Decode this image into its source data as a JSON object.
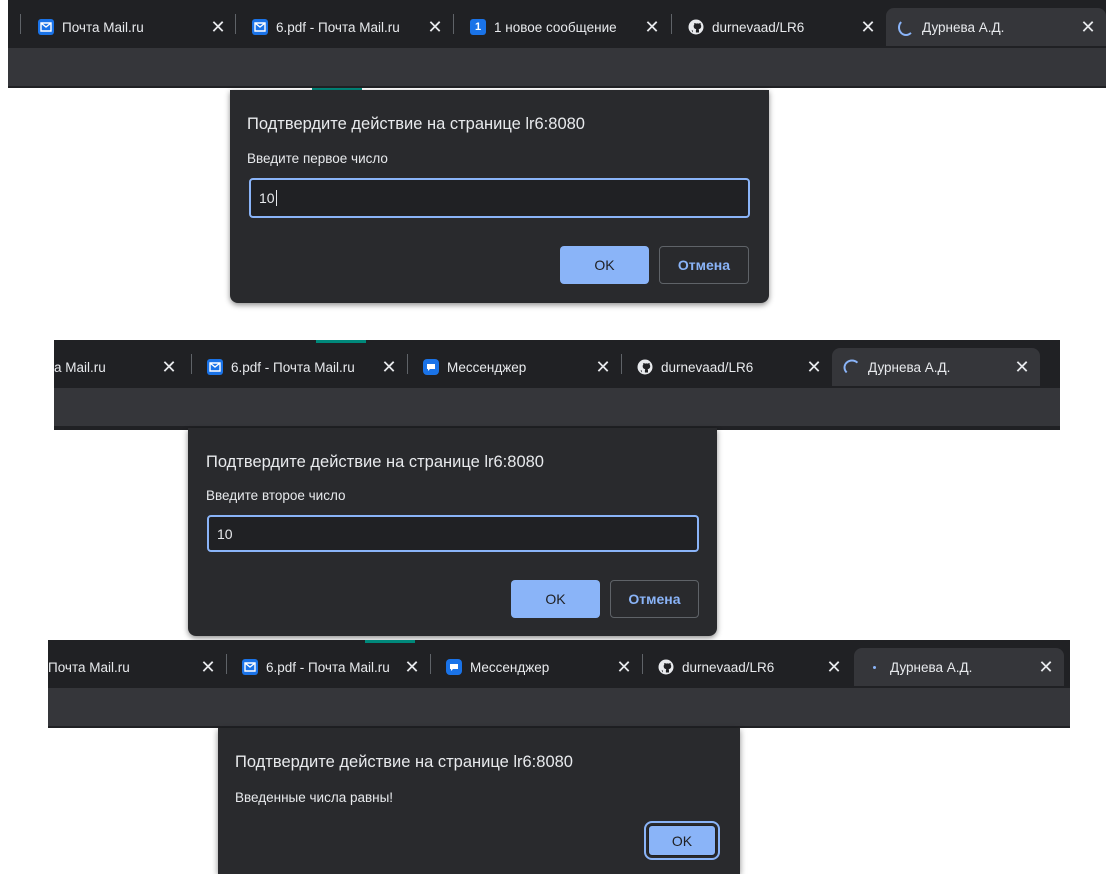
{
  "tab_close_glyph": "✕",
  "colors": {
    "tab_bar": "#202124",
    "toolbar": "#35363a",
    "dialog_bg": "#292a2d",
    "accent": "#8ab4f8",
    "favicon_blue": "#1a73e8"
  },
  "shots": [
    {
      "tabs": [
        {
          "title": "Почта Mail.ru",
          "icon": "mail-icon",
          "active": false
        },
        {
          "title": "6.pdf - Почта Mail.ru",
          "icon": "mail-icon",
          "active": false
        },
        {
          "title": "1 новое сообщение",
          "icon": "notification-count-icon",
          "badge": "1",
          "active": false
        },
        {
          "title": "durnevaad/LR6",
          "icon": "github-icon",
          "active": false
        },
        {
          "title": "Дурнева А.Д.",
          "icon": "loading-spinner-icon",
          "active": true
        }
      ],
      "dialog": {
        "title": "Подтвердите действие на странице lr6:8080",
        "message": "Введите первое число",
        "input_value": "10",
        "ok_label": "OK",
        "cancel_label": "Отмена"
      }
    },
    {
      "tabs": [
        {
          "title": "а Mail.ru",
          "icon": "",
          "active": false
        },
        {
          "title": "6.pdf - Почта Mail.ru",
          "icon": "mail-icon",
          "active": false
        },
        {
          "title": "Мессенджер",
          "icon": "messenger-icon",
          "active": false
        },
        {
          "title": "durnevaad/LR6",
          "icon": "github-icon",
          "active": false
        },
        {
          "title": "Дурнева А.Д.",
          "icon": "loading-spinner-icon",
          "active": true
        }
      ],
      "dialog": {
        "title": "Подтвердите действие на странице lr6:8080",
        "message": "Введите второе число",
        "input_value": "10",
        "ok_label": "OK",
        "cancel_label": "Отмена"
      }
    },
    {
      "tabs": [
        {
          "title": "Почта Mail.ru",
          "icon": "",
          "active": false
        },
        {
          "title": "6.pdf - Почта Mail.ru",
          "icon": "mail-icon",
          "active": false
        },
        {
          "title": "Мессенджер",
          "icon": "messenger-icon",
          "active": false
        },
        {
          "title": "durnevaad/LR6",
          "icon": "github-icon",
          "active": false
        },
        {
          "title": "Дурнева А.Д.",
          "icon": "loading-spinner-icon",
          "active": true
        }
      ],
      "dialog": {
        "title": "Подтвердите действие на странице lr6:8080",
        "message": "Введенные числа равны!",
        "ok_label": "OK"
      }
    }
  ]
}
